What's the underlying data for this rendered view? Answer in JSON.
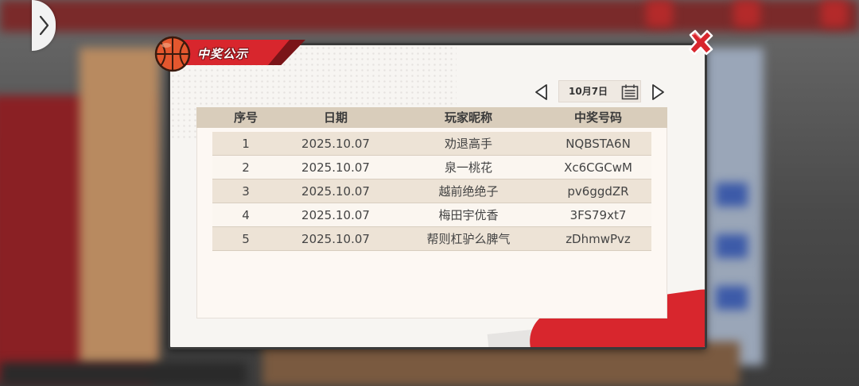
{
  "dialog": {
    "title": "中奖公示"
  },
  "date_picker": {
    "date_label": "10月7日"
  },
  "table": {
    "headers": [
      "序号",
      "日期",
      "玩家昵称",
      "中奖号码"
    ],
    "rows": [
      [
        "1",
        "2025.10.07",
        "劝退高手",
        "NQBSTA6N"
      ],
      [
        "2",
        "2025.10.07",
        "泉一桃花",
        "Xc6CGCwM"
      ],
      [
        "3",
        "2025.10.07",
        "越前绝绝子",
        "pv6ggdZR"
      ],
      [
        "4",
        "2025.10.07",
        "梅田宇优香",
        "3FS79xt7"
      ],
      [
        "5",
        "2025.10.07",
        "帮则杠驴么脾气",
        "zDhmwPvz"
      ]
    ]
  },
  "colors": {
    "accent_red": "#d8262d",
    "header_bg": "#d9cdbb",
    "row_odd": "#ede3d6",
    "row_even": "#fbf6f0"
  },
  "icons": {
    "back": "chevron-right-icon",
    "close": "close-icon",
    "ball": "basketball-icon",
    "prev": "triangle-left-icon",
    "next": "triangle-right-icon",
    "calendar": "calendar-icon"
  }
}
